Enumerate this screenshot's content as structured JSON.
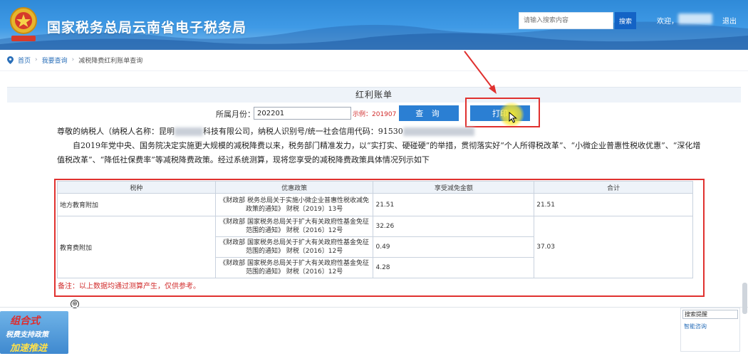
{
  "header": {
    "site_title": "国家税务总局云南省电子税务局",
    "search_placeholder": "请输入搜索内容",
    "search_button": "搜索",
    "welcome": "欢迎，",
    "logout": "退出",
    "brand_color": "#2f8ad8"
  },
  "breadcrumb": {
    "items": [
      "首页",
      "我要查询",
      "减税降费红利账单查询"
    ]
  },
  "main": {
    "title": "红利账单",
    "period_label": "所属月份：",
    "period_value": "202201",
    "period_example": "示例：201907",
    "query_button": "查 询",
    "print_button": "打印"
  },
  "letter": {
    "line1_a": "尊敬的纳税人（纳税人名称：昆明",
    "line1_b": "科技有限公司，纳税人识别号/统一社会信用代码：91530",
    "line2": "自2019年党中央、国务院决定实施更大规模的减税降费以来，税务部门精准发力，以“实打实、硬碰硬”的举措，贯彻落实好“个人所得税改革”、“小微企业普惠性税收优惠”、“深化增值税改革”、“降低社保费率”等减税降费政策。经过系统测算，现将您享受的减税降费政策具体情况列示如下"
  },
  "table": {
    "headers": [
      "税种",
      "优惠政策",
      "享受减免金额",
      "合计"
    ],
    "groups": [
      {
        "tax": "地方教育附加",
        "total": "21.51",
        "rows": [
          {
            "policy": "《财政部 税务总局关于实施小微企业普惠性税收减免政策的通知》 财税〔2019〕13号",
            "amount": "21.51"
          }
        ]
      },
      {
        "tax": "教育费附加",
        "total": "37.03",
        "rows": [
          {
            "policy": "《财政部 国家税务总局关于扩大有关政府性基金免征范围的通知》 财税〔2016〕12号",
            "amount": "32.26"
          },
          {
            "policy": "《财政部 国家税务总局关于扩大有关政府性基金免征范围的通知》 财税〔2016〕12号",
            "amount": "0.49"
          },
          {
            "policy": "《财政部 国家税务总局关于扩大有关政府性基金免征范围的通知》 财税〔2016〕12号",
            "amount": "4.28"
          }
        ]
      }
    ],
    "note": "备注：以上数据均通过测算产生，仅供参考。"
  },
  "promo": {
    "line1": "组合式",
    "line2": "税费支持政策",
    "line3": "加速推进"
  },
  "widget": {
    "input_value": "搜索提醒",
    "link": "智能咨询"
  },
  "plus_icon": "⊕"
}
